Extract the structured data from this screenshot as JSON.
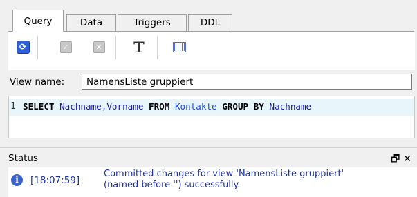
{
  "tabs": [
    {
      "label": "Query",
      "active": true
    },
    {
      "label": "Data",
      "active": false
    },
    {
      "label": "Triggers",
      "active": false
    },
    {
      "label": "DDL",
      "active": false
    }
  ],
  "toolbar": {
    "icons": [
      "refresh-icon",
      "apply-icon",
      "cancel-icon",
      "format-text-icon",
      "columns-icon"
    ]
  },
  "view": {
    "label": "View name:",
    "value": "NamensListe gruppiert"
  },
  "editor": {
    "line_number": "1",
    "sql": {
      "kw1": "SELECT",
      "cols": "Nachname,Vorname",
      "kw2": "FROM",
      "table": "Kontakte",
      "kw3": "GROUP BY",
      "group_col": "Nachname"
    }
  },
  "status": {
    "title": "Status",
    "timestamp": "[18:07:59]",
    "message_line1": "Committed changes for view 'NamensListe gruppiert'",
    "message_line2": "(named before '') successfully."
  },
  "colors": {
    "accent": "#2f5fd6",
    "status_text": "#1a2fa0",
    "current_line": "#e8f6fb"
  }
}
